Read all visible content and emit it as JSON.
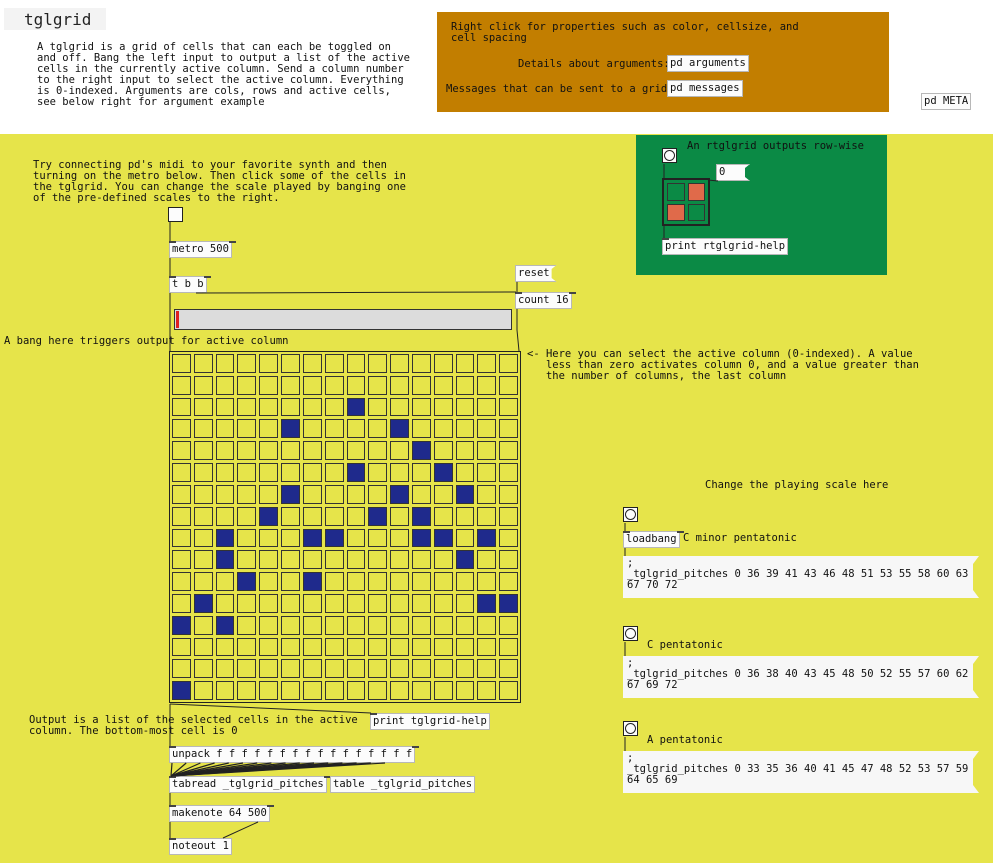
{
  "title": "tglgrid",
  "intro": "A tglgrid is a grid of cells that can each be toggled on\nand off. Bang the left input to output a list of the active\ncells in the currently active column. Send a column number\nto the right input to select the active column. Everything\nis 0-indexed. Arguments are cols, rows and active cells,\nsee below right for argument example",
  "props_note": "Right click for properties such as color, cellsize, and\ncell spacing",
  "details_label": "Details about arguments:",
  "pd_arguments": "pd arguments",
  "messages_label": "Messages that can be sent to a grid:",
  "pd_messages": "pd messages",
  "pd_meta": "pd META",
  "try_text": "Try connecting pd's midi to your favorite synth and then\nturning on the metro below. Then click some of the cells in\nthe tglgrid. You can change the scale played by banging one\nof the pre-defined scales to the right.",
  "metro": "metro 500",
  "tbb": "t b b",
  "reset": "reset",
  "count": "count 16",
  "bang_note": "A bang here triggers output for active column",
  "select_note": "<- Here you can select the active column (0-indexed). A value\n   less than zero activates column 0, and a value greater than\n   the number of columns, the last column",
  "rtgl_label": "An rtglgrid outputs row-wise",
  "rtgl_number": "0",
  "print_rtgl": "print rtglgrid-help",
  "output_note": "Output is a list of the selected cells in the active\ncolumn. The bottom-most cell is 0",
  "print_tgl": "print tglgrid-help",
  "unpack": "unpack f f f f f f f f f f f f f f f f",
  "tabread": "tabread _tglgrid_pitches",
  "table": "table _tglgrid_pitches",
  "makenote": "makenote 64 500",
  "noteout": "noteout 1",
  "scale_header": "Change the playing scale here",
  "loadbang": "loadbang",
  "scales": [
    {
      "name": "C minor pentatonic",
      "msg": ";\n_tglgrid_pitches 0 36 39 41 43 46 48 51 53 55 58 60 63 65\n67 70 72"
    },
    {
      "name": "C pentatonic",
      "msg": ";\n_tglgrid_pitches 0 36 38 40 43 45 48 50 52 55 57 60 62 64\n67 69 72"
    },
    {
      "name": "A pentatonic",
      "msg": ";\n_tglgrid_pitches 0 33 35 36 40 41 45 47 48 52 53 57 59 60\n64 65 69"
    }
  ],
  "grid": {
    "cols": 16,
    "rows": 16,
    "active_cells": [
      [
        2,
        8
      ],
      [
        4,
        12
      ],
      [
        4,
        10
      ],
      [
        5,
        11
      ],
      [
        5,
        14
      ],
      [
        6,
        9
      ],
      [
        6,
        13
      ],
      [
        7,
        8
      ],
      [
        7,
        11
      ],
      [
        8,
        12
      ],
      [
        8,
        6
      ],
      [
        9,
        6
      ],
      [
        9,
        10
      ],
      [
        10,
        7
      ],
      [
        11,
        9
      ],
      [
        11,
        13
      ],
      [
        13,
        4
      ],
      [
        13,
        7
      ],
      [
        14,
        10
      ],
      [
        15,
        10
      ],
      [
        15,
        8
      ],
      [
        16,
        3
      ],
      [
        16,
        12
      ],
      [
        16,
        11
      ],
      [
        17,
        7
      ],
      [
        17,
        6
      ],
      [
        17,
        12
      ],
      [
        17,
        13
      ],
      [
        18,
        14
      ]
    ]
  },
  "rtgl": {
    "cells": [
      0,
      1,
      1,
      0
    ]
  },
  "colors": {
    "canvas": "#e6e44a",
    "header": "#ffffff",
    "orange": "#c27e00",
    "green": "#0b8a45",
    "cell_on": "#1f2a8c",
    "rcell_on": "#e06a4a"
  }
}
